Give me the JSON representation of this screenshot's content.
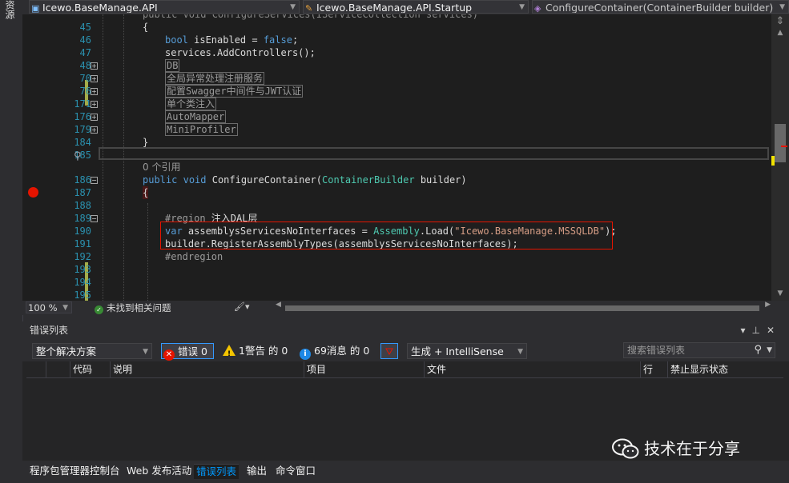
{
  "left_strip": {
    "label": "资源"
  },
  "nav": {
    "project": "Icewo.BaseManage.API",
    "class": "Icewo.BaseManage.API.Startup",
    "member": "ConfigureContainer(ContainerBuilder builder)"
  },
  "editor": {
    "top_partial_line": "public void ConfigureServices(IServiceCollection services)",
    "line_numbers": [
      "45",
      "46",
      "47",
      "48",
      "70",
      "76",
      "171",
      "176",
      "179",
      "184",
      "185",
      "",
      "186",
      "187",
      "188",
      "189",
      "190",
      "191",
      "192",
      "193",
      "194",
      "195"
    ],
    "brace_open": "{",
    "bool_kw": "bool",
    "is_enabled": " isEnabled = ",
    "false_kw": "false",
    "semicolon": ";",
    "services_call": "services.AddControllers();",
    "region_db": "DB",
    "region_global": "全局异常处理注册服务",
    "region_swagger": "配置Swagger中间件与JWT认证",
    "region_singleton": "单个类注入",
    "region_automapper": "AutoMapper",
    "region_miniprofiler": "MiniProfiler",
    "brace_close": "}",
    "ref_count": "0 个引用",
    "public_kw": "public",
    "void_kw": "void",
    "method_name": " ConfigureContainer(",
    "param_type": "ContainerBuilder",
    "param_name": " builder)",
    "region_start_kw": "#region",
    "region_start_label": " 注入DAL层",
    "var_kw": "var",
    "var_name": " assemblysServicesNoInterfaces = ",
    "assembly_type": "Assembly",
    "load_call": ".Load(",
    "string_arg": "\"Icewo.BaseManage.MSSQLDB\"",
    "load_end": ");",
    "builder_call": "builder.RegisterAssemblyTypes(assemblysServicesNoInterfaces);",
    "endregion_kw": "#endregion"
  },
  "status": {
    "zoom": "100 %",
    "issues": "未找到相关问题"
  },
  "error_list": {
    "title": "错误列表",
    "scope": "整个解决方案",
    "errors": "错误 0",
    "warnings": "1警告 的 0",
    "messages": "69消息 的 0",
    "build_filter": "生成 + IntelliSense",
    "search_placeholder": "搜索错误列表",
    "columns": [
      "代码",
      "说明",
      "项目",
      "文件",
      "行",
      "禁止显示状态"
    ]
  },
  "bottom_tabs": [
    "程序包管理器控制台",
    "Web 发布活动",
    "错误列表",
    "输出",
    "命令窗口"
  ],
  "watermark": "技术在于分享",
  "colors": {
    "keyword": "#569cd6",
    "type": "#4ec9b0",
    "string": "#d69d85",
    "line_number": "#2b91af",
    "breakpoint": "#e51400",
    "highlight_box": "#e51400"
  }
}
